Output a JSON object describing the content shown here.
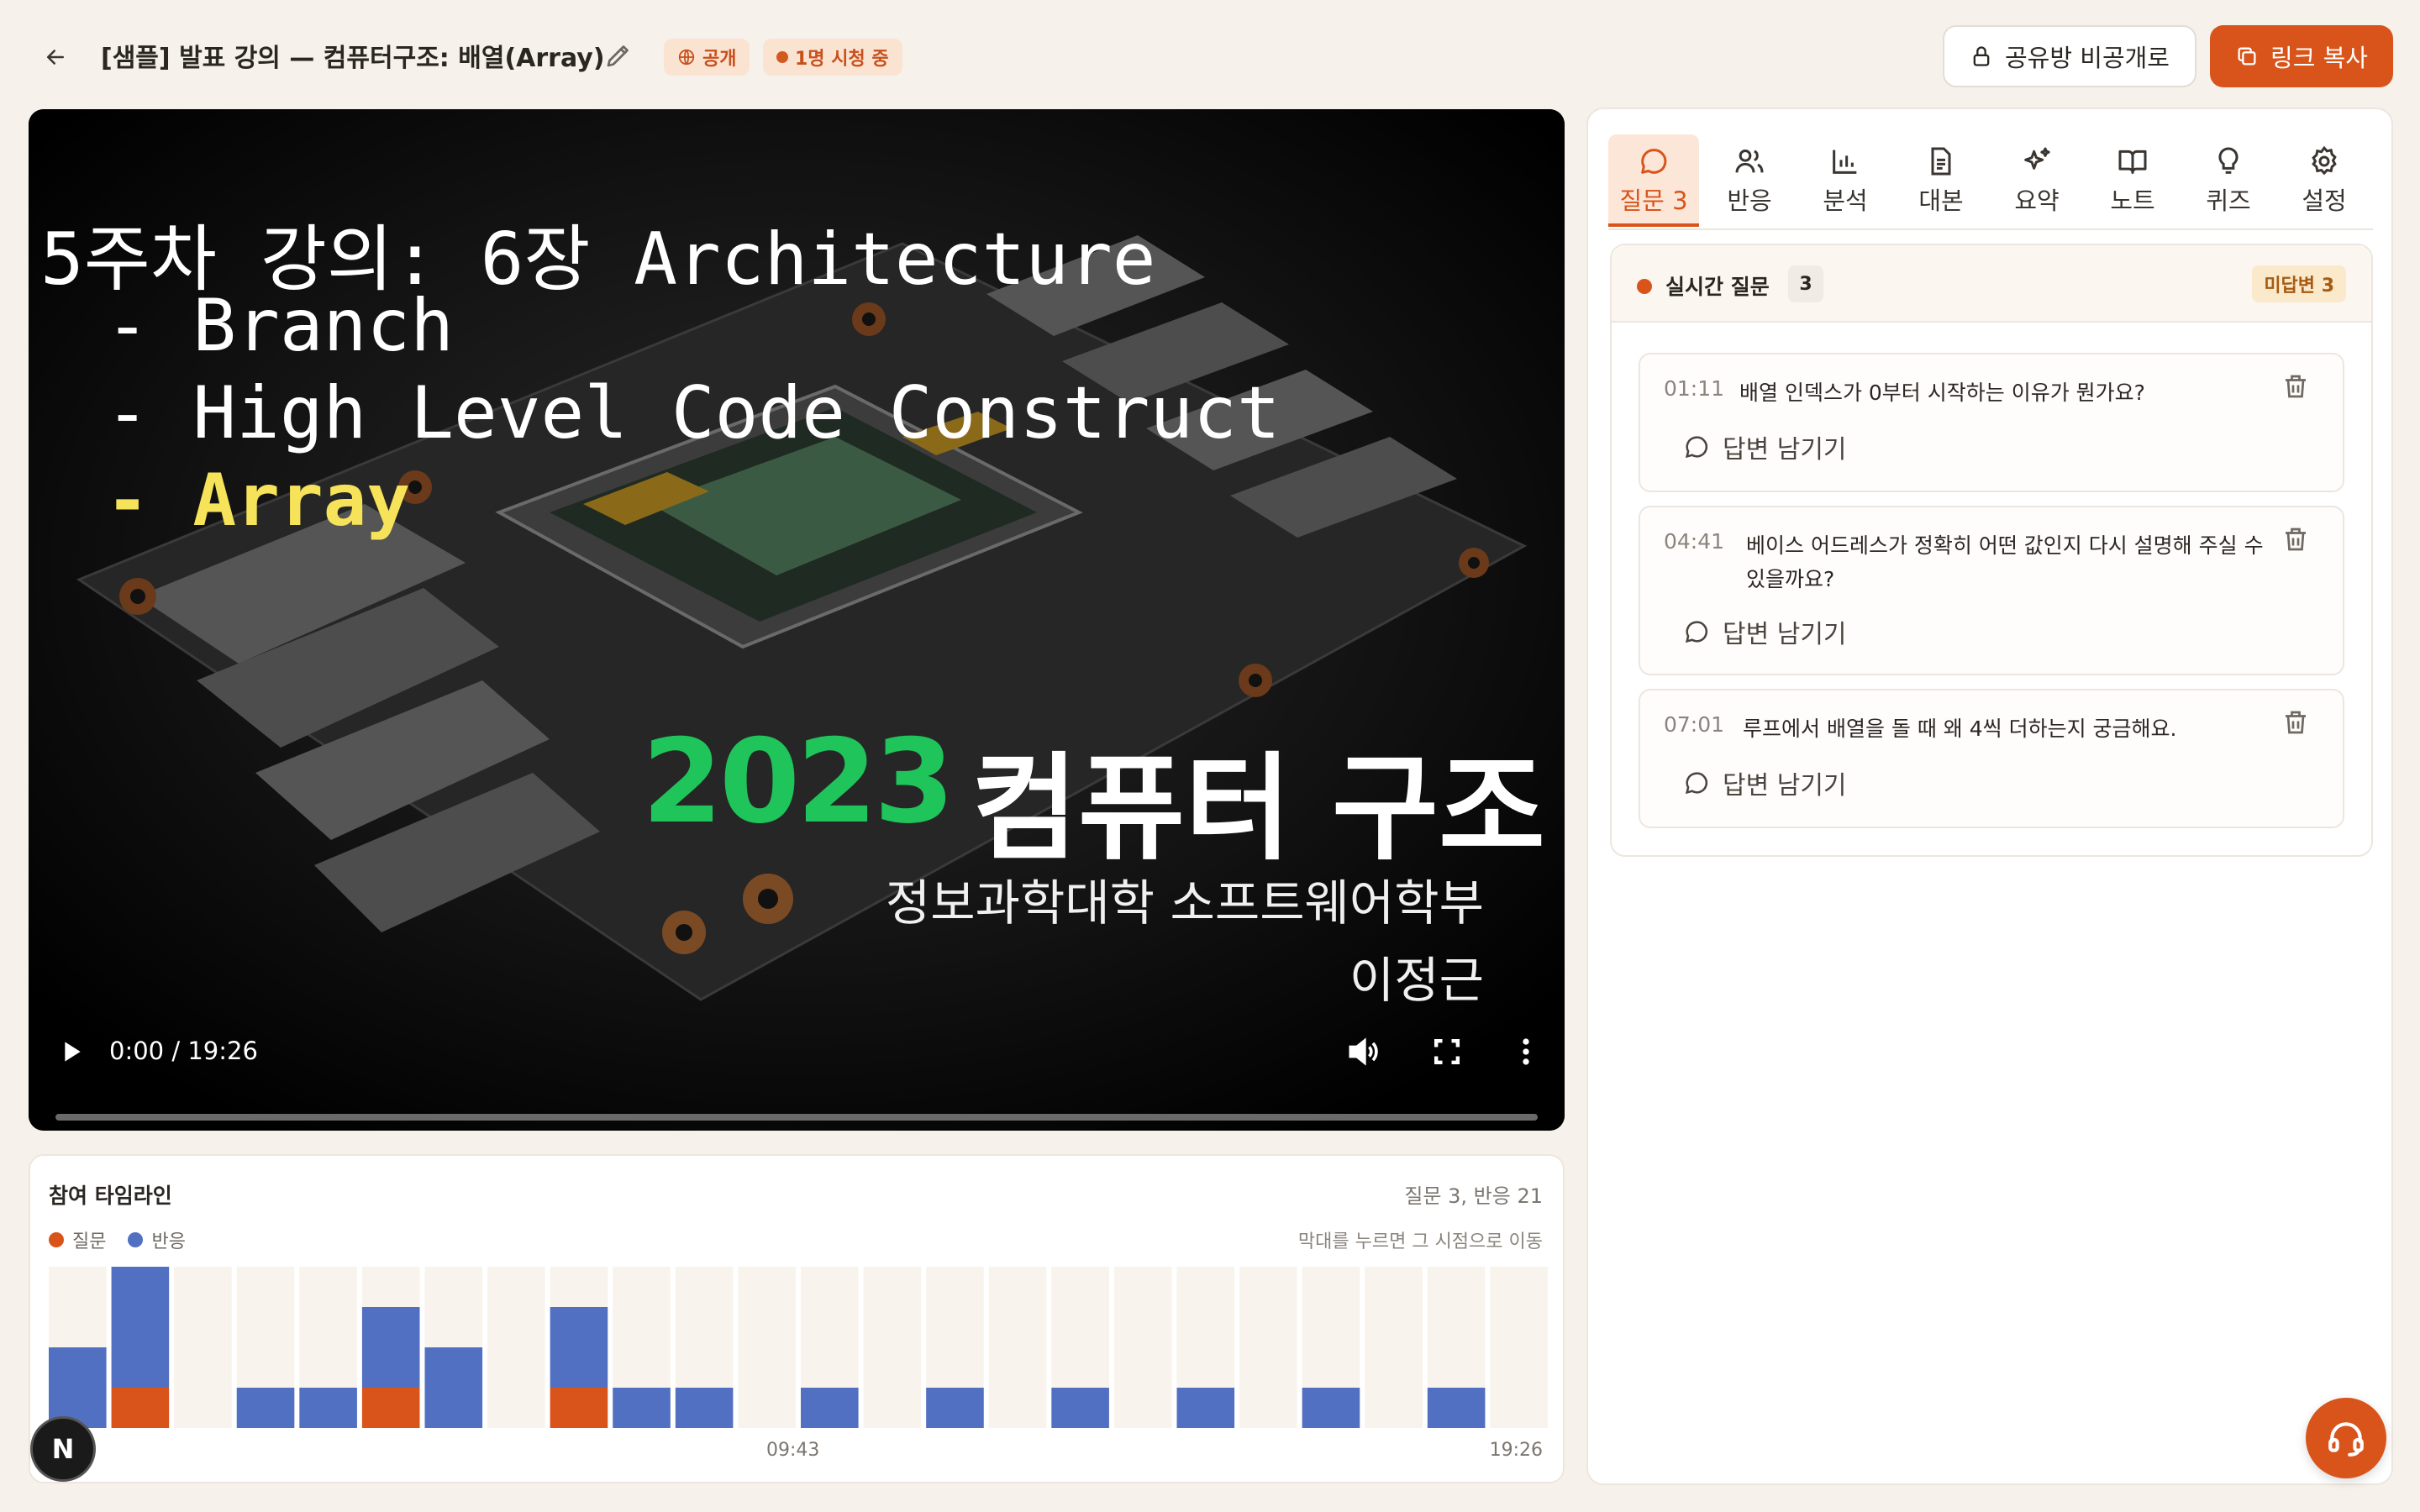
{
  "header": {
    "title": "[샘플] 발표 강의 — 컴퓨터구조: 배열(Array)",
    "badge_public": "공개",
    "badge_viewers": "1명 시청 중",
    "private_button": "공유방 비공개로",
    "copy_button": "링크 복사"
  },
  "video": {
    "slide_line1": "5주차 강의: 6장 Architecture",
    "slide_line2": " - Branch",
    "slide_line3": " - High Level Code Construct",
    "slide_line4": " - Array",
    "title_year": "2023",
    "title_text": "컴퓨터 구조",
    "sub_line1": "정보과학대학 소프트웨어학부",
    "sub_line2": "이정근",
    "time": "0:00 / 19:26",
    "progress": 0
  },
  "timeline": {
    "title": "참여 타임라인",
    "stats": "질문 3, 반응 21",
    "legend_questions": "질문",
    "legend_reactions": "반응",
    "hint": "막대를 누르면 그 시점으로 이동",
    "x_mid": "09:43",
    "x_end": "19:26",
    "colors": {
      "question": "#d9541a",
      "reaction": "#5270c2",
      "empty": "#f8f3ec"
    },
    "max": 4,
    "bars": [
      {
        "q": 0,
        "r": 2
      },
      {
        "q": 1,
        "r": 3
      },
      {
        "q": 0,
        "r": 0
      },
      {
        "q": 0,
        "r": 1
      },
      {
        "q": 0,
        "r": 1
      },
      {
        "q": 1,
        "r": 2
      },
      {
        "q": 0,
        "r": 2
      },
      {
        "q": 0,
        "r": 0
      },
      {
        "q": 1,
        "r": 2
      },
      {
        "q": 0,
        "r": 1
      },
      {
        "q": 0,
        "r": 1
      },
      {
        "q": 0,
        "r": 0
      },
      {
        "q": 0,
        "r": 1
      },
      {
        "q": 0,
        "r": 0
      },
      {
        "q": 0,
        "r": 1
      },
      {
        "q": 0,
        "r": 0
      },
      {
        "q": 0,
        "r": 1
      },
      {
        "q": 0,
        "r": 0
      },
      {
        "q": 0,
        "r": 1
      },
      {
        "q": 0,
        "r": 0
      },
      {
        "q": 0,
        "r": 1
      },
      {
        "q": 0,
        "r": 0
      },
      {
        "q": 0,
        "r": 1
      },
      {
        "q": 0,
        "r": 0
      }
    ]
  },
  "tabs": [
    {
      "label": "질문 3",
      "icon": "chat-bubble-icon"
    },
    {
      "label": "반응",
      "icon": "users-icon"
    },
    {
      "label": "분석",
      "icon": "bar-chart-icon"
    },
    {
      "label": "대본",
      "icon": "document-icon"
    },
    {
      "label": "요약",
      "icon": "sparkles-icon"
    },
    {
      "label": "노트",
      "icon": "book-icon"
    },
    {
      "label": "퀴즈",
      "icon": "lightbulb-icon"
    },
    {
      "label": "설정",
      "icon": "gear-icon"
    }
  ],
  "questions_panel": {
    "title": "실시간 질문",
    "count": "3",
    "unanswered": "미답변 3",
    "reply_label": "답변 남기기",
    "items": [
      {
        "time": "01:11",
        "text": "배열 인덱스가 0부터 시작하는 이유가 뭔가요?"
      },
      {
        "time": "04:41",
        "text": "베이스 어드레스가 정확히 어떤 값인지 다시 설명해 주실 수 있을까요?"
      },
      {
        "time": "07:01",
        "text": "루프에서 배열을 돌 때 왜 4씩 더하는지 궁금해요."
      }
    ]
  },
  "badge_n": "N"
}
